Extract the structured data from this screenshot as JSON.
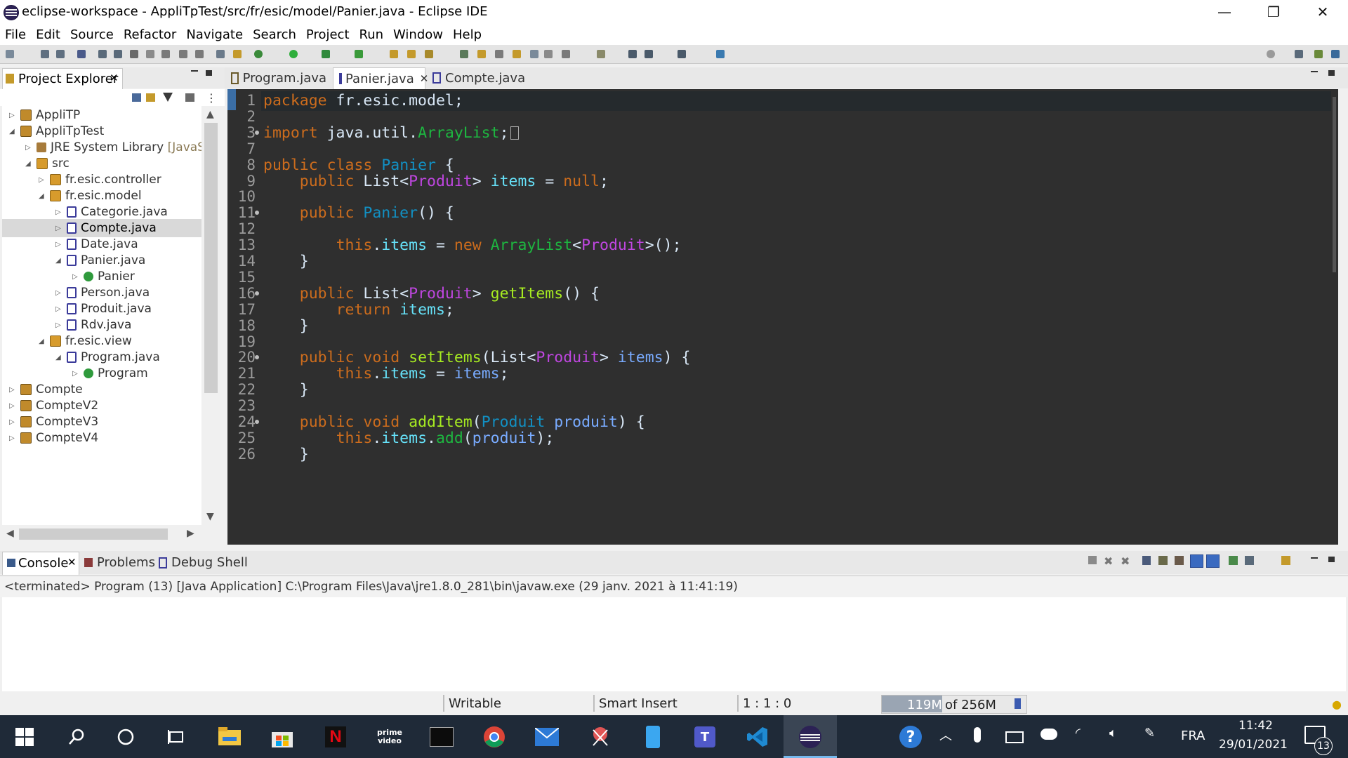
{
  "window": {
    "title": "eclipse-workspace - AppliTpTest/src/fr/esic/model/Panier.java - Eclipse IDE",
    "controls": {
      "minimize": "—",
      "restore": "❐",
      "close": "✕"
    }
  },
  "menu": [
    "File",
    "Edit",
    "Source",
    "Refactor",
    "Navigate",
    "Search",
    "Project",
    "Run",
    "Window",
    "Help"
  ],
  "project_explorer": {
    "title": "Project Explorer",
    "close": "✕",
    "items": [
      {
        "label": "AppliTP",
        "arrow": "▷",
        "icon": "project-icon"
      },
      {
        "label": "AppliTpTest",
        "arrow": "◢",
        "icon": "project-icon"
      },
      {
        "label": "JRE System Library",
        "suffix": "[JavaSE-",
        "arrow": "▷",
        "icon": "library-icon"
      },
      {
        "label": "src",
        "arrow": "◢",
        "icon": "source-folder-icon"
      },
      {
        "label": "fr.esic.controller",
        "arrow": "▷",
        "icon": "package-icon"
      },
      {
        "label": "fr.esic.model",
        "arrow": "◢",
        "icon": "package-icon"
      },
      {
        "label": "Categorie.java",
        "arrow": "▷",
        "icon": "java-file-icon"
      },
      {
        "label": "Compte.java",
        "arrow": "▷",
        "icon": "java-file-icon",
        "selected": true
      },
      {
        "label": "Date.java",
        "arrow": "▷",
        "icon": "java-file-icon"
      },
      {
        "label": "Panier.java",
        "arrow": "◢",
        "icon": "java-file-icon"
      },
      {
        "label": "Panier",
        "arrow": "▷",
        "icon": "class-icon"
      },
      {
        "label": "Person.java",
        "arrow": "▷",
        "icon": "java-file-icon"
      },
      {
        "label": "Produit.java",
        "arrow": "▷",
        "icon": "java-file-icon"
      },
      {
        "label": "Rdv.java",
        "arrow": "▷",
        "icon": "java-file-icon"
      },
      {
        "label": "fr.esic.view",
        "arrow": "◢",
        "icon": "package-icon"
      },
      {
        "label": "Program.java",
        "arrow": "◢",
        "icon": "java-file-icon"
      },
      {
        "label": "Program",
        "arrow": "▷",
        "icon": "class-icon"
      },
      {
        "label": "Compte",
        "arrow": "▷",
        "icon": "project-icon"
      },
      {
        "label": "CompteV2",
        "arrow": "▷",
        "icon": "project-icon"
      },
      {
        "label": "CompteV3",
        "arrow": "▷",
        "icon": "project-icon"
      },
      {
        "label": "CompteV4",
        "arrow": "▷",
        "icon": "project-icon"
      }
    ]
  },
  "editor": {
    "tabs": [
      {
        "label": "Program.java",
        "active": false
      },
      {
        "label": "Panier.java",
        "active": true,
        "close": "✕"
      },
      {
        "label": "Compte.java",
        "active": false
      }
    ],
    "lines": [
      {
        "n": "1",
        "t": "package fr.esic.model;"
      },
      {
        "n": "2",
        "t": ""
      },
      {
        "n": "3",
        "t": "import java.util.ArrayList;"
      },
      {
        "n": "7",
        "t": ""
      },
      {
        "n": "8",
        "t": "public class Panier {"
      },
      {
        "n": "9",
        "t": "    public List<Produit> items = null;"
      },
      {
        "n": "10",
        "t": ""
      },
      {
        "n": "11",
        "t": "    public Panier() {"
      },
      {
        "n": "12",
        "t": ""
      },
      {
        "n": "13",
        "t": "        this.items = new ArrayList<Produit>();"
      },
      {
        "n": "14",
        "t": "    }"
      },
      {
        "n": "15",
        "t": ""
      },
      {
        "n": "16",
        "t": "    public List<Produit> getItems() {"
      },
      {
        "n": "17",
        "t": "        return items;"
      },
      {
        "n": "18",
        "t": "    }"
      },
      {
        "n": "19",
        "t": ""
      },
      {
        "n": "20",
        "t": "    public void setItems(List<Produit> items) {"
      },
      {
        "n": "21",
        "t": "        this.items = items;"
      },
      {
        "n": "22",
        "t": "    }"
      },
      {
        "n": "23",
        "t": ""
      },
      {
        "n": "24",
        "t": "    public void addItem(Produit produit) {"
      },
      {
        "n": "25",
        "t": "        this.items.add(produit);"
      },
      {
        "n": "26",
        "t": "    }"
      }
    ]
  },
  "console": {
    "tabs": [
      {
        "label": "Console",
        "active": true,
        "close": "✕"
      },
      {
        "label": "Problems",
        "active": false
      },
      {
        "label": "Debug Shell",
        "active": false
      }
    ],
    "status_line": "<terminated> Program (13) [Java Application] C:\\Program Files\\Java\\jre1.8.0_281\\bin\\javaw.exe (29 janv. 2021 à 11:41:19)"
  },
  "statusbar": {
    "writable": "Writable",
    "insert_mode": "Smart Insert",
    "position": "1 : 1 : 0",
    "heap_used": "119M",
    "heap_of": "of 256M",
    "heap_fraction": 0.465
  },
  "taskbar": {
    "lang": "FRA",
    "time": "11:42",
    "date": "29/01/2021",
    "notifications": "13",
    "prime_label": "prime video"
  },
  "colors": {
    "editor_bg": "#2f2f2f",
    "keyword": "#cc6c1d",
    "type": "#1290c3",
    "generic": "#bf46e0",
    "field": "#66e1f8",
    "taskbar": "#1f2a38"
  }
}
